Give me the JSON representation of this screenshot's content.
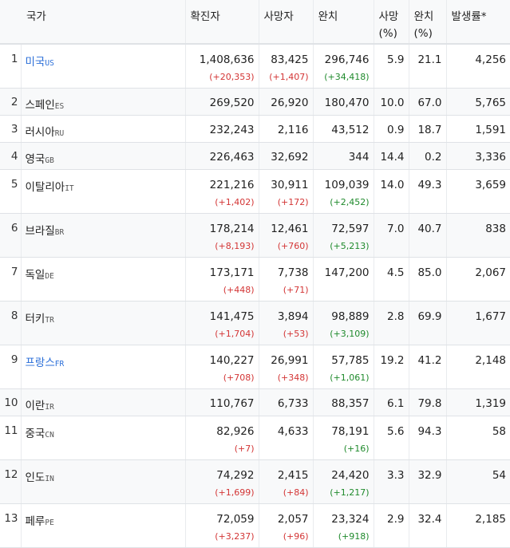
{
  "headers": {
    "country": "국가",
    "confirmed": "확진자",
    "deaths": "사망자",
    "recovered": "완치",
    "death_rate_line1": "사망",
    "death_rate_line2": "(%)",
    "recovery_rate_line1": "완치",
    "recovery_rate_line2": "(%)",
    "incidence": "발생률*"
  },
  "colors": {
    "link": "#2a6ed8",
    "increase": "#d33535",
    "recovered_increase": "#1f8a2c",
    "header_bg": "#f8f9fa"
  },
  "rows": [
    {
      "rank": "1",
      "name": "미국",
      "code": "US",
      "link": true,
      "confirmed": "1,408,636",
      "confirmed_delta": "(+20,353)",
      "deaths": "83,425",
      "deaths_delta": "(+1,407)",
      "recovered": "296,746",
      "recovered_delta": "(+34,418)",
      "death_rate": "5.9",
      "recovery_rate": "21.1",
      "incidence": "4,256"
    },
    {
      "rank": "2",
      "name": "스페인",
      "code": "ES",
      "link": false,
      "confirmed": "269,520",
      "confirmed_delta": "",
      "deaths": "26,920",
      "deaths_delta": "",
      "recovered": "180,470",
      "recovered_delta": "",
      "death_rate": "10.0",
      "recovery_rate": "67.0",
      "incidence": "5,765"
    },
    {
      "rank": "3",
      "name": "러시아",
      "code": "RU",
      "link": false,
      "confirmed": "232,243",
      "confirmed_delta": "",
      "deaths": "2,116",
      "deaths_delta": "",
      "recovered": "43,512",
      "recovered_delta": "",
      "death_rate": "0.9",
      "recovery_rate": "18.7",
      "incidence": "1,591"
    },
    {
      "rank": "4",
      "name": "영국",
      "code": "GB",
      "link": false,
      "confirmed": "226,463",
      "confirmed_delta": "",
      "deaths": "32,692",
      "deaths_delta": "",
      "recovered": "344",
      "recovered_delta": "",
      "death_rate": "14.4",
      "recovery_rate": "0.2",
      "incidence": "3,336"
    },
    {
      "rank": "5",
      "name": "이탈리아",
      "code": "IT",
      "link": false,
      "confirmed": "221,216",
      "confirmed_delta": "(+1,402)",
      "deaths": "30,911",
      "deaths_delta": "(+172)",
      "recovered": "109,039",
      "recovered_delta": "(+2,452)",
      "death_rate": "14.0",
      "recovery_rate": "49.3",
      "incidence": "3,659"
    },
    {
      "rank": "6",
      "name": "브라질",
      "code": "BR",
      "link": false,
      "confirmed": "178,214",
      "confirmed_delta": "(+8,193)",
      "deaths": "12,461",
      "deaths_delta": "(+760)",
      "recovered": "72,597",
      "recovered_delta": "(+5,213)",
      "death_rate": "7.0",
      "recovery_rate": "40.7",
      "incidence": "838"
    },
    {
      "rank": "7",
      "name": "독일",
      "code": "DE",
      "link": false,
      "confirmed": "173,171",
      "confirmed_delta": "(+448)",
      "deaths": "7,738",
      "deaths_delta": "(+71)",
      "recovered": "147,200",
      "recovered_delta": "",
      "death_rate": "4.5",
      "recovery_rate": "85.0",
      "incidence": "2,067"
    },
    {
      "rank": "8",
      "name": "터키",
      "code": "TR",
      "link": false,
      "confirmed": "141,475",
      "confirmed_delta": "(+1,704)",
      "deaths": "3,894",
      "deaths_delta": "(+53)",
      "recovered": "98,889",
      "recovered_delta": "(+3,109)",
      "death_rate": "2.8",
      "recovery_rate": "69.9",
      "incidence": "1,677"
    },
    {
      "rank": "9",
      "name": "프랑스",
      "code": "FR",
      "link": true,
      "confirmed": "140,227",
      "confirmed_delta": "(+708)",
      "deaths": "26,991",
      "deaths_delta": "(+348)",
      "recovered": "57,785",
      "recovered_delta": "(+1,061)",
      "death_rate": "19.2",
      "recovery_rate": "41.2",
      "incidence": "2,148"
    },
    {
      "rank": "10",
      "name": "이란",
      "code": "IR",
      "link": false,
      "confirmed": "110,767",
      "confirmed_delta": "",
      "deaths": "6,733",
      "deaths_delta": "",
      "recovered": "88,357",
      "recovered_delta": "",
      "death_rate": "6.1",
      "recovery_rate": "79.8",
      "incidence": "1,319"
    },
    {
      "rank": "11",
      "name": "중국",
      "code": "CN",
      "link": false,
      "confirmed": "82,926",
      "confirmed_delta": "(+7)",
      "deaths": "4,633",
      "deaths_delta": "",
      "recovered": "78,191",
      "recovered_delta": "(+16)",
      "death_rate": "5.6",
      "recovery_rate": "94.3",
      "incidence": "58"
    },
    {
      "rank": "12",
      "name": "인도",
      "code": "IN",
      "link": false,
      "confirmed": "74,292",
      "confirmed_delta": "(+1,699)",
      "deaths": "2,415",
      "deaths_delta": "(+84)",
      "recovered": "24,420",
      "recovered_delta": "(+1,217)",
      "death_rate": "3.3",
      "recovery_rate": "32.9",
      "incidence": "54"
    },
    {
      "rank": "13",
      "name": "페루",
      "code": "PE",
      "link": false,
      "confirmed": "72,059",
      "confirmed_delta": "(+3,237)",
      "deaths": "2,057",
      "deaths_delta": "(+96)",
      "recovered": "23,324",
      "recovered_delta": "(+918)",
      "death_rate": "2.9",
      "recovery_rate": "32.4",
      "incidence": "2,185"
    }
  ]
}
